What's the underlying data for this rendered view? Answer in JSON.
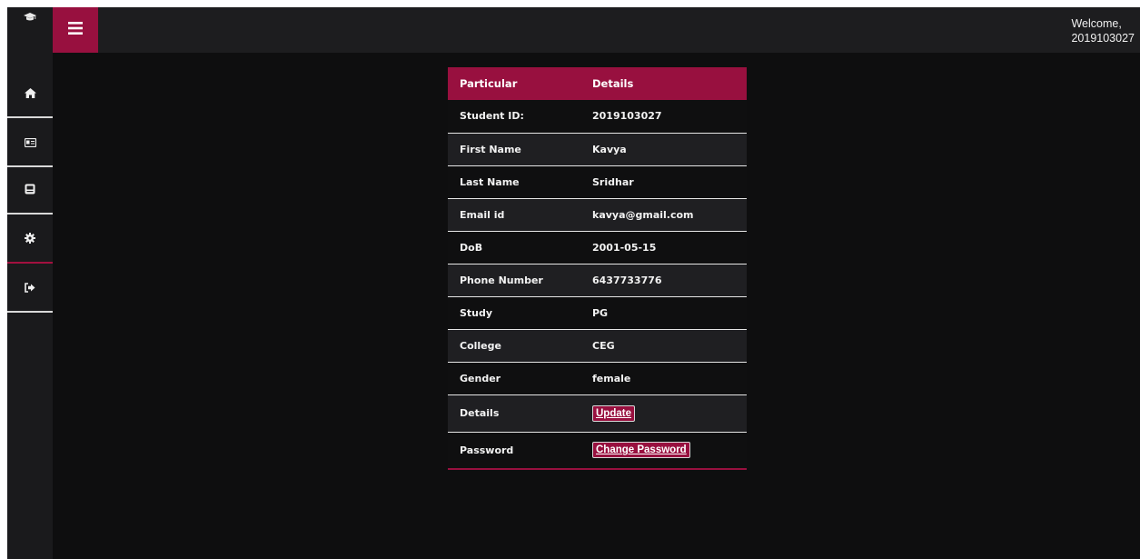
{
  "header": {
    "welcome_line1": "Welcome,",
    "welcome_line2": "2019103027"
  },
  "sidebar": {
    "items": [
      {
        "icon": "home-icon"
      },
      {
        "icon": "id-card-icon"
      },
      {
        "icon": "inbox-icon"
      },
      {
        "icon": "gear-icon"
      },
      {
        "icon": "sign-out-icon"
      }
    ]
  },
  "table": {
    "headers": [
      "Particular",
      "Details"
    ],
    "rows": [
      {
        "label": "Student ID:",
        "value": "2019103027"
      },
      {
        "label": "First Name",
        "value": "Kavya"
      },
      {
        "label": "Last Name",
        "value": "Sridhar"
      },
      {
        "label": "Email id",
        "value": "kavya@gmail.com"
      },
      {
        "label": "DoB",
        "value": "2001-05-15"
      },
      {
        "label": "Phone Number",
        "value": "6437733776"
      },
      {
        "label": "Study",
        "value": "PG"
      },
      {
        "label": "College",
        "value": "CEG"
      },
      {
        "label": "Gender",
        "value": "female"
      }
    ],
    "details_label": "Details",
    "update_button": "Update",
    "password_label": "Password",
    "change_password_button": "Change Password"
  },
  "colors": {
    "accent": "#98103f",
    "background": "#0e0e0f",
    "sidebar": "#1a1a1c"
  }
}
